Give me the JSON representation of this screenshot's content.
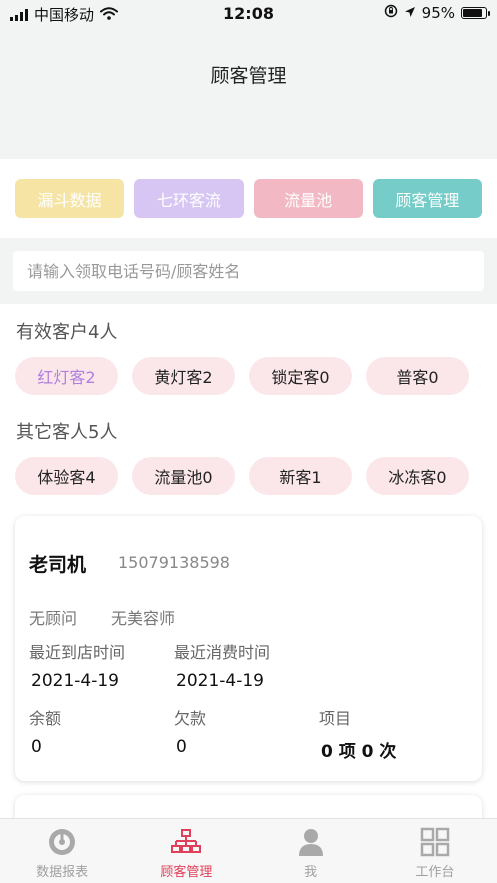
{
  "status_bar": {
    "carrier": "中国移动",
    "time": "12:08",
    "battery": "95%",
    "battery_level": 0.95,
    "icons": [
      "signal-icon",
      "wifi-icon",
      "orientation-lock-icon",
      "location-icon",
      "battery-icon"
    ]
  },
  "header": {
    "title": "顾客管理"
  },
  "tabs": [
    {
      "label": "漏斗数据",
      "color": "#f6e4a4"
    },
    {
      "label": "七环客流",
      "color": "#d7c6f3"
    },
    {
      "label": "流量池",
      "color": "#f2b9c4"
    },
    {
      "label": "顾客管理",
      "color": "#75ccc8"
    }
  ],
  "search": {
    "placeholder": "请输入领取电话号码/顾客姓名",
    "value": ""
  },
  "effective": {
    "title": "有效客户4人",
    "pills": [
      "红灯客2",
      "黄灯客2",
      "锁定客0",
      "普客0"
    ],
    "active_color": "#b07fe0"
  },
  "others": {
    "title": "其它客人5人",
    "pills": [
      "体验客4",
      "流量池0",
      "新客1",
      "冰冻客0"
    ]
  },
  "customer": {
    "name": "老司机",
    "phone": "15079138598",
    "consultant": "无顾问",
    "beautician": "无美容师",
    "last_visit_label": "最近到店时间",
    "last_visit": "2021-4-19",
    "last_spend_label": "最近消费时间",
    "last_spend": "2021-4-19",
    "balance_label": "余额",
    "balance": "0",
    "debt_label": "欠款",
    "debt": "0",
    "items_label": "项目",
    "items": "0 项 0 次"
  },
  "tabbar": [
    {
      "label": "数据报表",
      "icon": "chart-gauge-icon",
      "active": false
    },
    {
      "label": "顾客管理",
      "icon": "org-chart-icon",
      "active": true
    },
    {
      "label": "我",
      "icon": "user-icon",
      "active": false
    },
    {
      "label": "工作台",
      "icon": "grid-icon",
      "active": false
    }
  ],
  "colors": {
    "accent": "#e0405a",
    "pill_bg": "#fbe7ea",
    "header_bg": "#f2f3f3"
  }
}
